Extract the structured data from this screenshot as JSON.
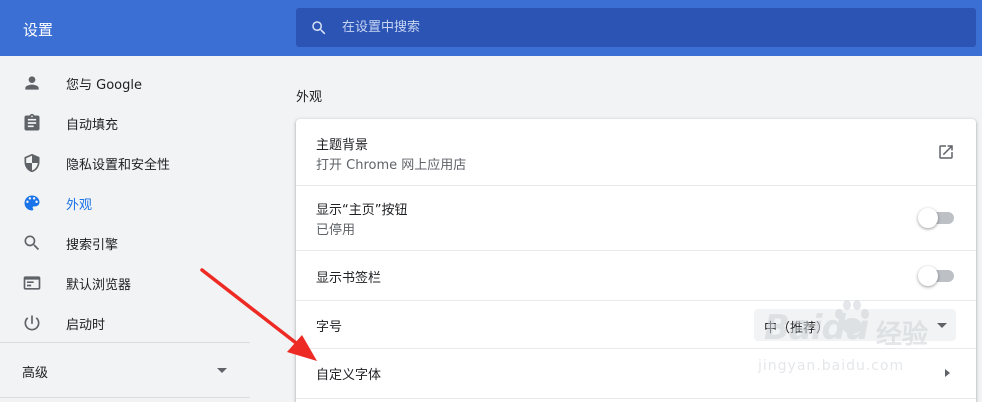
{
  "app": {
    "title": "设置"
  },
  "search": {
    "placeholder": "在设置中搜索"
  },
  "sidebar": {
    "items": [
      {
        "label": "您与 Google",
        "icon": "person-icon"
      },
      {
        "label": "自动填充",
        "icon": "clipboard-icon"
      },
      {
        "label": "隐私设置和安全性",
        "icon": "shield-icon"
      },
      {
        "label": "外观",
        "icon": "palette-icon",
        "active": true
      },
      {
        "label": "搜索引擎",
        "icon": "search-icon"
      },
      {
        "label": "默认浏览器",
        "icon": "browser-window-icon"
      },
      {
        "label": "启动时",
        "icon": "power-icon"
      }
    ],
    "advanced_label": "高级"
  },
  "section": {
    "title": "外观"
  },
  "settings": {
    "theme": {
      "label": "主题背景",
      "sublabel": "打开 Chrome 网上应用店",
      "icon": "open-in-new-icon"
    },
    "home_button": {
      "label": "显示“主页”按钮",
      "sublabel": "已停用",
      "enabled": false
    },
    "bookmarks_bar": {
      "label": "显示书签栏",
      "enabled": false
    },
    "font_size": {
      "label": "字号",
      "value": "中（推荐）"
    },
    "custom_fonts": {
      "label": "自定义字体"
    }
  },
  "watermark": {
    "brand": "Baidu",
    "cn": "经验",
    "url": "jingyan.baidu.com"
  },
  "colors": {
    "header": "#3b6fd4",
    "search_bg": "#2c54b5",
    "accent": "#1a73e8",
    "arrow": "#ee2a24"
  }
}
